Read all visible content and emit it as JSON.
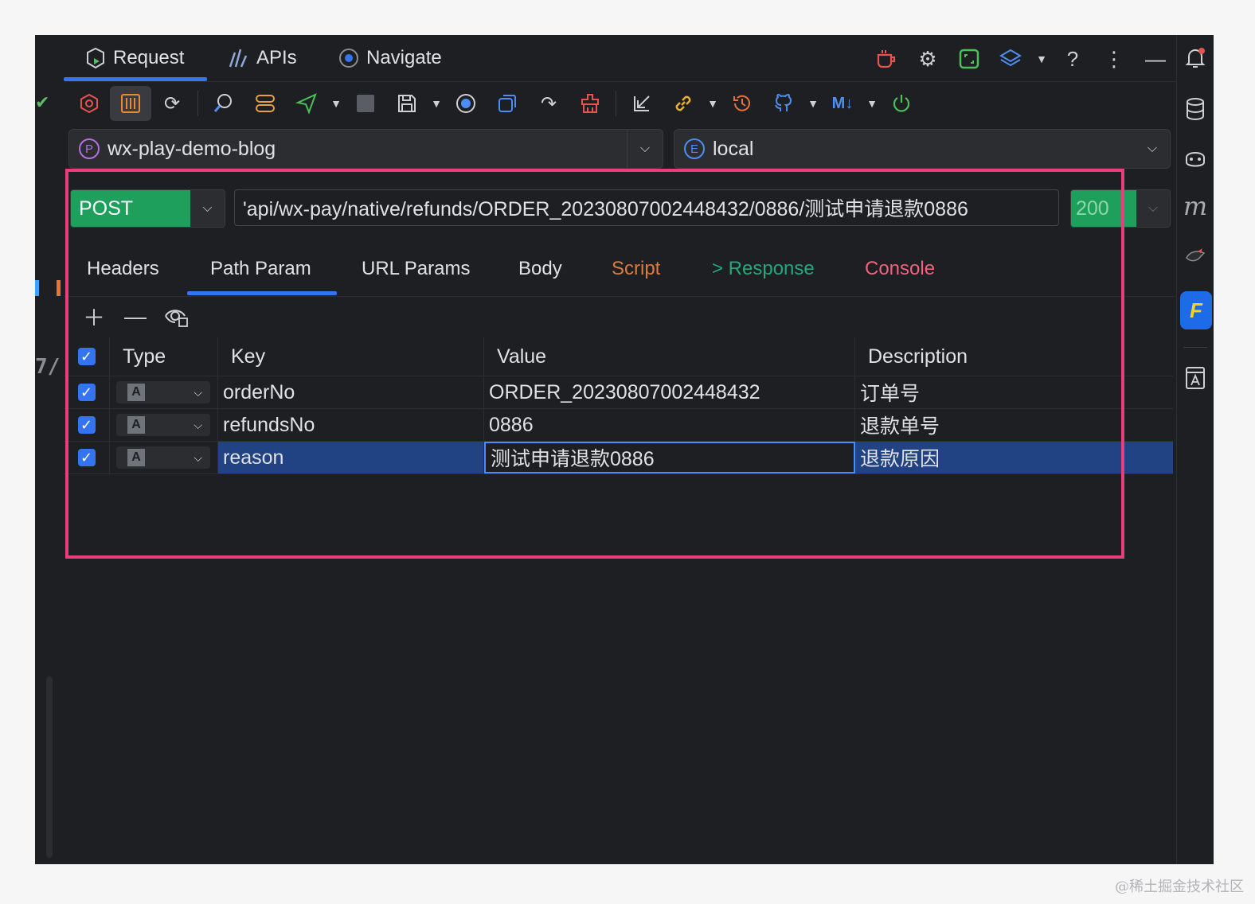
{
  "top_tabs": [
    {
      "label": "Request",
      "icon": "request-icon"
    },
    {
      "label": "APIs",
      "icon": "apis-icon"
    },
    {
      "label": "Navigate",
      "icon": "navigate-icon"
    }
  ],
  "top_icons": [
    "coffee-icon",
    "gear-icon",
    "window-icon",
    "layers-icon",
    "chevron-down-icon",
    "help-icon",
    "more-icon",
    "minimize-icon"
  ],
  "toolbar_icons": [
    "hexagon-icon",
    "sliders-icon",
    "refresh-icon",
    "search-api-icon",
    "server-icon",
    "send-icon",
    "stop-icon",
    "save-icon",
    "record-icon",
    "copy-icon",
    "redo-icon",
    "clear-icon",
    "import-icon",
    "link-icon",
    "history-icon",
    "github-icon",
    "markdown-icon",
    "power-icon"
  ],
  "toolbar_md_label": "M↓",
  "project": {
    "badge": "P",
    "name": "wx-play-demo-blog"
  },
  "environment": {
    "badge": "E",
    "name": "local"
  },
  "request": {
    "method": "POST",
    "url": "'api/wx-pay/native/refunds/ORDER_20230807002448432/0886/测试申请退款0886",
    "status": "200"
  },
  "sub_tabs": [
    {
      "label": "Headers",
      "color": "#dfe1e5"
    },
    {
      "label": "Path Param",
      "color": "#dfe1e5"
    },
    {
      "label": "URL Params",
      "color": "#dfe1e5"
    },
    {
      "label": "Body",
      "color": "#dfe1e5"
    },
    {
      "label": "Script",
      "color": "#e0793a"
    },
    {
      "label": "> Response",
      "color": "#22a97a"
    },
    {
      "label": "Console",
      "color": "#f2617f"
    }
  ],
  "params_table": {
    "columns": [
      "Type",
      "Key",
      "Value",
      "Description"
    ],
    "rows": [
      {
        "checked": true,
        "type": "A",
        "key": "orderNo",
        "value": "ORDER_20230807002448432",
        "description": "订单号"
      },
      {
        "checked": true,
        "type": "A",
        "key": "refundsNo",
        "value": "0886",
        "description": "退款单号"
      },
      {
        "checked": true,
        "type": "A",
        "key": "reason",
        "value": "测试申请退款0886",
        "description": "退款原因"
      }
    ]
  },
  "gutter_number": "7/",
  "right_icons": [
    "bell-icon",
    "database-icon",
    "copilot-icon",
    "m-icon",
    "bird-icon",
    "fast-request-icon",
    "font-icon"
  ],
  "right_m_label": "m",
  "right_fav_label": "F",
  "watermark": "@稀土掘金技术社区"
}
